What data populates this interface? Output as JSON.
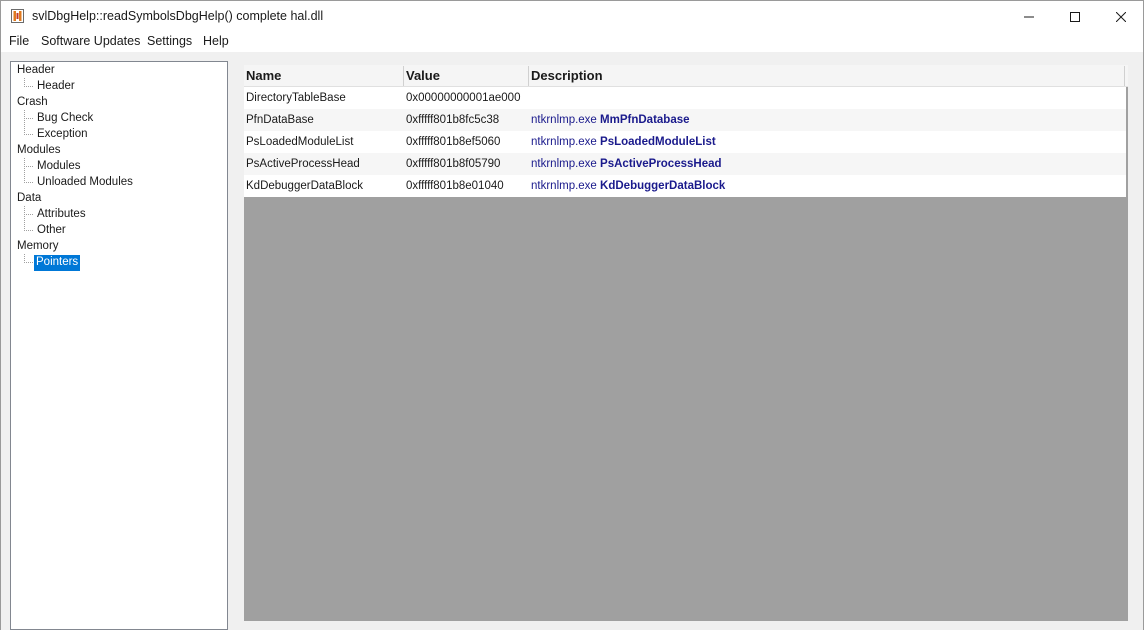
{
  "window": {
    "title": "svlDbgHelp::readSymbolsDbgHelp() complete hal.dll"
  },
  "menu": [
    "File",
    "Software Updates",
    "Settings",
    "Help"
  ],
  "tree": {
    "groups": [
      {
        "label": "Header",
        "children": [
          "Header"
        ]
      },
      {
        "label": "Crash",
        "children": [
          "Bug Check",
          "Exception"
        ]
      },
      {
        "label": "Modules",
        "children": [
          "Modules",
          "Unloaded Modules"
        ]
      },
      {
        "label": "Data",
        "children": [
          "Attributes",
          "Other"
        ]
      },
      {
        "label": "Memory",
        "children": [
          "Pointers"
        ]
      }
    ],
    "selected": "Pointers"
  },
  "list": {
    "columns": [
      "Name",
      "Value",
      "Description"
    ],
    "rows": [
      {
        "name": "DirectoryTableBase",
        "value": "0x00000000001ae000",
        "module": "",
        "symbol": ""
      },
      {
        "name": "PfnDataBase",
        "value": "0xfffff801b8fc5c38",
        "module": "ntkrnlmp.exe",
        "symbol": "MmPfnDatabase"
      },
      {
        "name": "PsLoadedModuleList",
        "value": "0xfffff801b8ef5060",
        "module": "ntkrnlmp.exe",
        "symbol": "PsLoadedModuleList"
      },
      {
        "name": "PsActiveProcessHead",
        "value": "0xfffff801b8f05790",
        "module": "ntkrnlmp.exe",
        "symbol": "PsActiveProcessHead"
      },
      {
        "name": "KdDebuggerDataBlock",
        "value": "0xfffff801b8e01040",
        "module": "ntkrnlmp.exe",
        "symbol": "KdDebuggerDataBlock"
      }
    ]
  },
  "colors": {
    "selection": "#0078d7",
    "description_text": "#1a1a8c",
    "list_background": "#a0a0a0"
  }
}
